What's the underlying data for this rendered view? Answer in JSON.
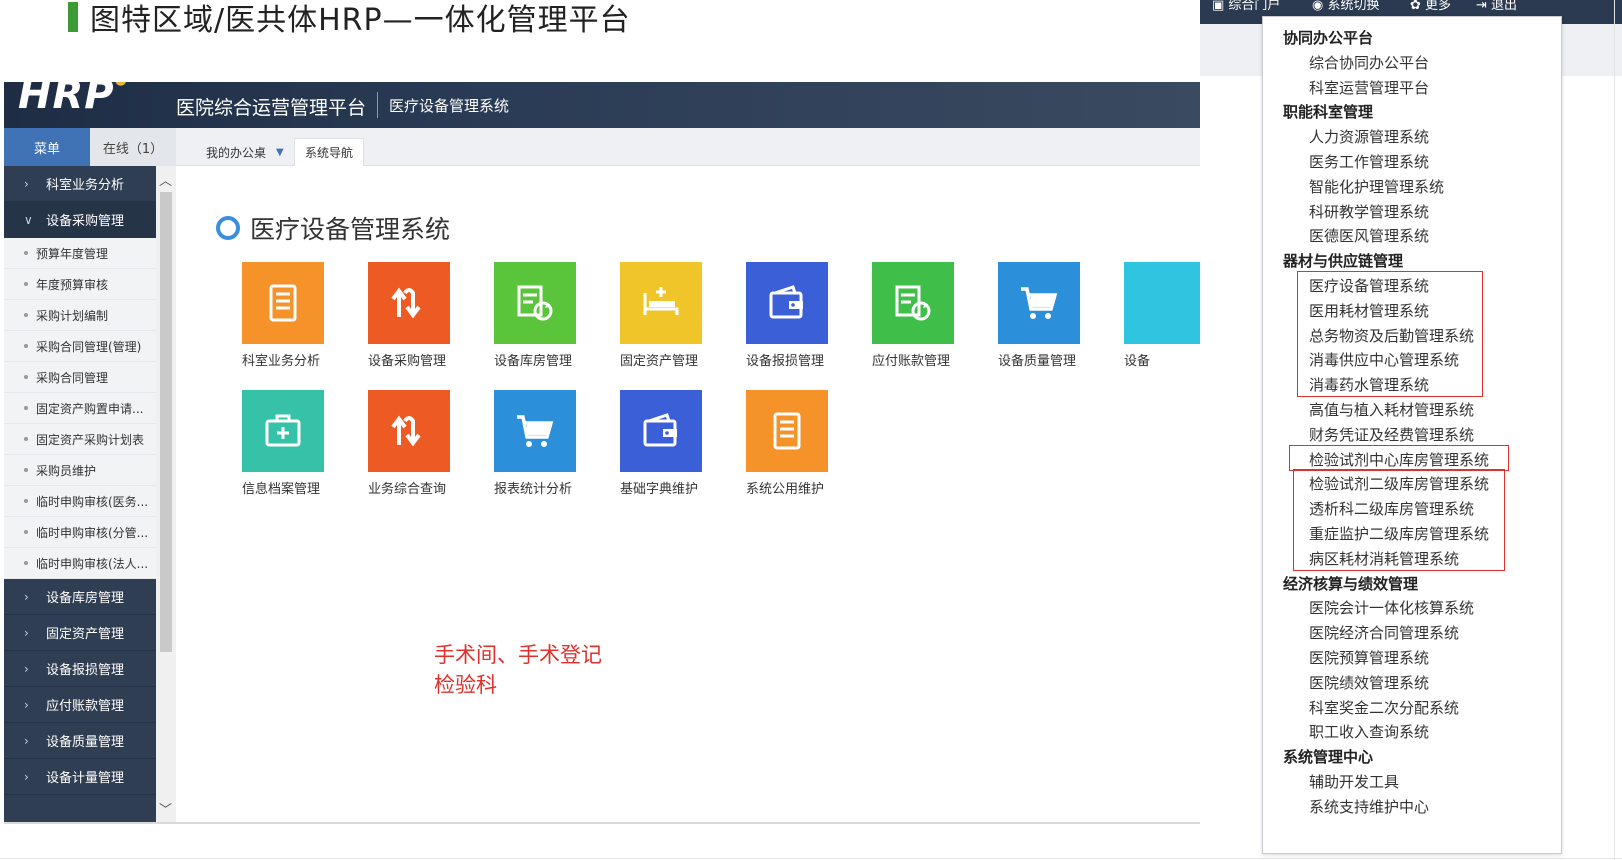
{
  "slide": {
    "title": "图特区域/医共体HRP—一体化管理平台"
  },
  "app": {
    "logo": "HRP",
    "header_title": "医院综合运营管理平台",
    "header_subtitle": "医疗设备管理系统"
  },
  "sidebar": {
    "tabs": [
      "菜单",
      "在线（1）"
    ],
    "items_top": [
      {
        "label": "科室业务分析",
        "state": "collapsed"
      },
      {
        "label": "设备采购管理",
        "state": "expanded"
      }
    ],
    "sub_items": [
      "预算年度管理",
      "年度预算审核",
      "采购计划编制",
      "采购合同管理(管理)",
      "采购合同管理",
      "固定资产购置申请...",
      "固定资产采购计划表",
      "采购员维护",
      "临时申购审核(医务...",
      "临时申购审核(分管...",
      "临时申购审核(法人..."
    ],
    "items_bottom": [
      "设备库房管理",
      "固定资产管理",
      "设备报损管理",
      "应付账款管理",
      "设备质量管理",
      "设备计量管理"
    ]
  },
  "main": {
    "tabs": [
      "我的办公桌",
      "系统导航"
    ],
    "system_title": "医疗设备管理系统",
    "tiles_row1": [
      {
        "label": "科室业务分析",
        "color": "#f5922a",
        "icon": "document-icon"
      },
      {
        "label": "设备采购管理",
        "color": "#ee5a24",
        "icon": "exchange-arrows-icon"
      },
      {
        "label": "设备库房管理",
        "color": "#5ac43a",
        "icon": "inventory-refresh-icon"
      },
      {
        "label": "固定资产管理",
        "color": "#f0c52a",
        "icon": "hospital-bed-icon"
      },
      {
        "label": "设备报损管理",
        "color": "#3b5fd6",
        "icon": "wallet-icon"
      },
      {
        "label": "应付账款管理",
        "color": "#3fbf4a",
        "icon": "inventory-refresh-icon"
      },
      {
        "label": "设备质量管理",
        "color": "#2b8fd9",
        "icon": "cart-icon"
      },
      {
        "label": "设备",
        "color": "#2fc5e0",
        "icon": "generic-icon"
      }
    ],
    "tiles_row2": [
      {
        "label": "信息档案管理",
        "color": "#35c2a8",
        "icon": "medical-kit-icon"
      },
      {
        "label": "业务综合查询",
        "color": "#ee5a24",
        "icon": "exchange-arrows-icon"
      },
      {
        "label": "报表统计分析",
        "color": "#2b8fd9",
        "icon": "cart-icon"
      },
      {
        "label": "基础字典维护",
        "color": "#3b5fd6",
        "icon": "wallet-icon"
      },
      {
        "label": "系统公用维护",
        "color": "#f5922a",
        "icon": "document-icon"
      }
    ],
    "annotation": [
      "手术间、手术登记",
      "检验科"
    ]
  },
  "top_links": [
    "综合门户",
    "系统切换",
    "更多",
    "退出"
  ],
  "system_menu": [
    {
      "category": "协同办公平台",
      "items": [
        "综合协同办公平台",
        "科室运营管理平台"
      ]
    },
    {
      "category": "职能科室管理",
      "items": [
        "人力资源管理系统",
        "医务工作管理系统",
        "智能化护理管理系统",
        "科研教学管理系统",
        "医德医风管理系统"
      ]
    },
    {
      "category": "器材与供应链管理",
      "items": [
        "医疗设备管理系统",
        "医用耗材管理系统",
        "总务物资及后勤管理系统",
        "消毒供应中心管理系统",
        "消毒药水管理系统",
        "高值与植入耗材管理系统",
        "财务凭证及经费管理系统",
        "检验试剂中心库房管理系统",
        "检验试剂二级库房管理系统",
        "透析科二级库房管理系统",
        "重症监护二级库房管理系统",
        "病区耗材消耗管理系统"
      ]
    },
    {
      "category": "经济核算与绩效管理",
      "items": [
        "医院会计一体化核算系统",
        "医院经济合同管理系统",
        "医院预算管理系统",
        "医院绩效管理系统",
        "科室奖金二次分配系统",
        "职工收入查询系统"
      ]
    },
    {
      "category": "系统管理中心",
      "items": [
        "辅助开发工具",
        "系统支持维护中心"
      ]
    }
  ],
  "colors": {
    "accent_red": "#e0312d",
    "header_dark": "#2a3b55",
    "sidebar_bg": "#2f3e52",
    "tab_active": "#3f73b6"
  }
}
